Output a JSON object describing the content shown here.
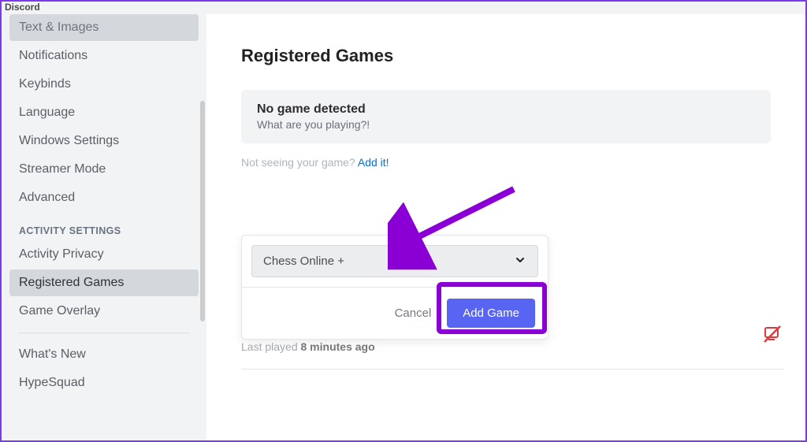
{
  "app": {
    "title": "Discord"
  },
  "sidebar": {
    "items_top": [
      {
        "label": "Text & Images",
        "selected": "cut"
      },
      {
        "label": "Notifications"
      },
      {
        "label": "Keybinds"
      },
      {
        "label": "Language"
      },
      {
        "label": "Windows Settings"
      },
      {
        "label": "Streamer Mode"
      },
      {
        "label": "Advanced"
      }
    ],
    "section_activity": "ACTIVITY SETTINGS",
    "items_activity": [
      {
        "label": "Activity Privacy"
      },
      {
        "label": "Registered Games",
        "selected": "selected"
      },
      {
        "label": "Game Overlay"
      }
    ],
    "items_bottom": [
      {
        "label": "What's New"
      },
      {
        "label": "HypeSquad"
      }
    ]
  },
  "main": {
    "title": "Registered Games",
    "no_game_title": "No game detected",
    "no_game_sub": "What are you playing?!",
    "not_seeing": "Not seeing your game? ",
    "add_it": "Add it!",
    "dropdown_value": "Chess Online +",
    "cancel": "Cancel",
    "add_game": "Add Game",
    "last_played_prefix": "Last played ",
    "last_played_value": "8 minutes ago"
  }
}
